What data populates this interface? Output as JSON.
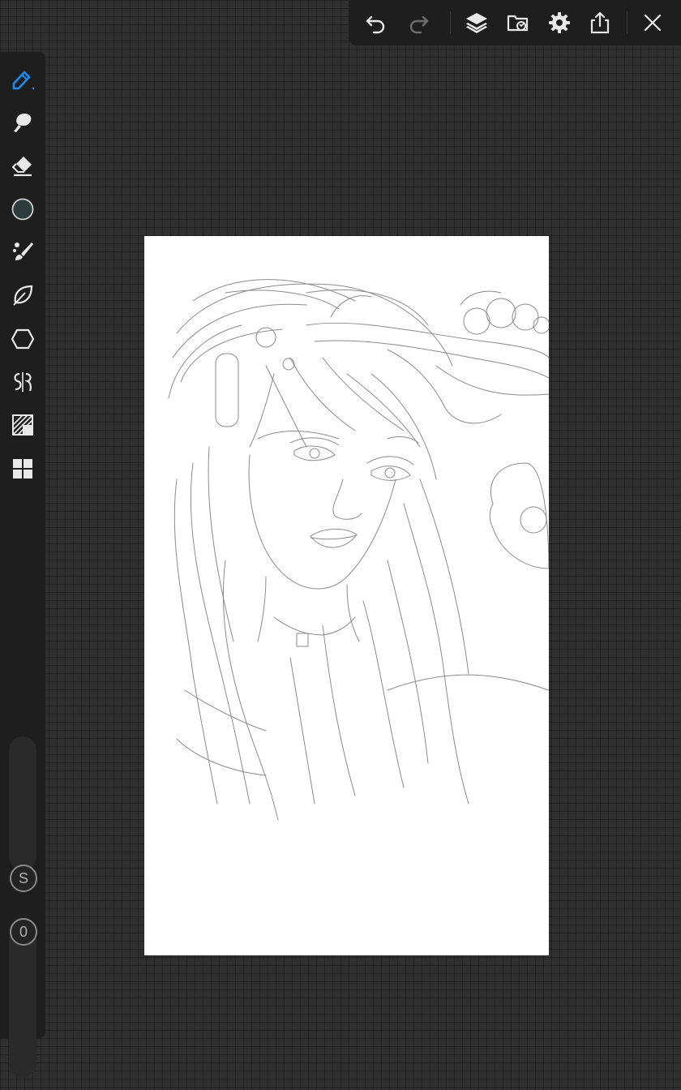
{
  "app": {
    "accent_color": "#1b8cf0",
    "toolbar_bg": "#1e1e1e",
    "icon_color": "#e8e8e8",
    "disabled_icon_color": "#6e6e6e",
    "canvas_bg": "#ffffff"
  },
  "top_toolbar": {
    "items": [
      {
        "icon": "undo-icon",
        "enabled": true
      },
      {
        "icon": "redo-icon",
        "enabled": false
      },
      {
        "icon": "layers-icon",
        "enabled": true
      },
      {
        "icon": "folder-sync-icon",
        "enabled": true
      },
      {
        "icon": "gear-icon",
        "enabled": true
      },
      {
        "icon": "share-icon",
        "enabled": true
      },
      {
        "icon": "close-icon",
        "enabled": true
      }
    ]
  },
  "left_toolbar": {
    "tools": [
      {
        "icon": "pencil-icon",
        "selected": true
      },
      {
        "icon": "smudge-icon",
        "selected": false
      },
      {
        "icon": "eraser-icon",
        "selected": false
      },
      {
        "icon": "color-swatch-icon",
        "selected": false,
        "color": "#2c3b3c"
      },
      {
        "icon": "brush-library-icon",
        "selected": false
      },
      {
        "icon": "leaf-icon",
        "selected": false
      },
      {
        "icon": "hexagon-shape-icon",
        "selected": false
      },
      {
        "icon": "symmetry-icon",
        "selected": false
      },
      {
        "icon": "fill-pattern-icon",
        "selected": false
      },
      {
        "icon": "grid-layout-icon",
        "selected": false
      }
    ],
    "slider": {
      "size_label": "S",
      "opacity_label": "0"
    }
  }
}
